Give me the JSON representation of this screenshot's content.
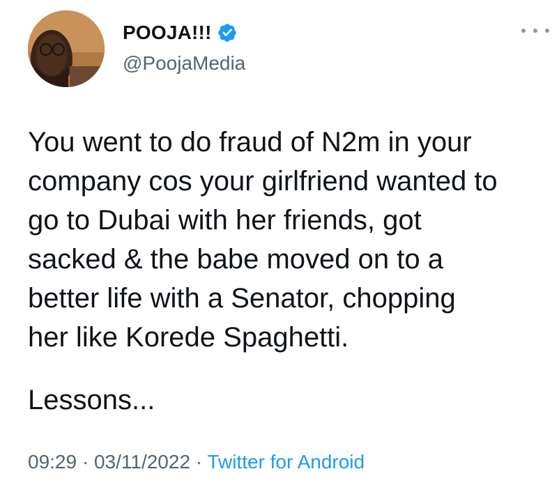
{
  "author": {
    "display_name": "POOJA!!!",
    "handle": "@PoojaMedia",
    "verified_icon": "verified-badge-icon",
    "avatar_icon": "profile-avatar"
  },
  "tweet": {
    "lines": [
      "You went to do fraud of N2m in your",
      "company cos your girlfriend wanted to",
      "go to Dubai with her friends, got",
      "sacked & the babe moved on to a",
      "better life with a Senator, chopping",
      "her like Korede Spaghetti."
    ],
    "followup": "Lessons..."
  },
  "meta": {
    "time": "09:29",
    "separator": " · ",
    "date": "03/11/2022",
    "source": "Twitter for Android"
  },
  "more_icon": "more-options-icon",
  "colors": {
    "text": "#0f1419",
    "secondary": "#536471",
    "link": "#1d9bf0",
    "verified": "#1d9bf0"
  }
}
